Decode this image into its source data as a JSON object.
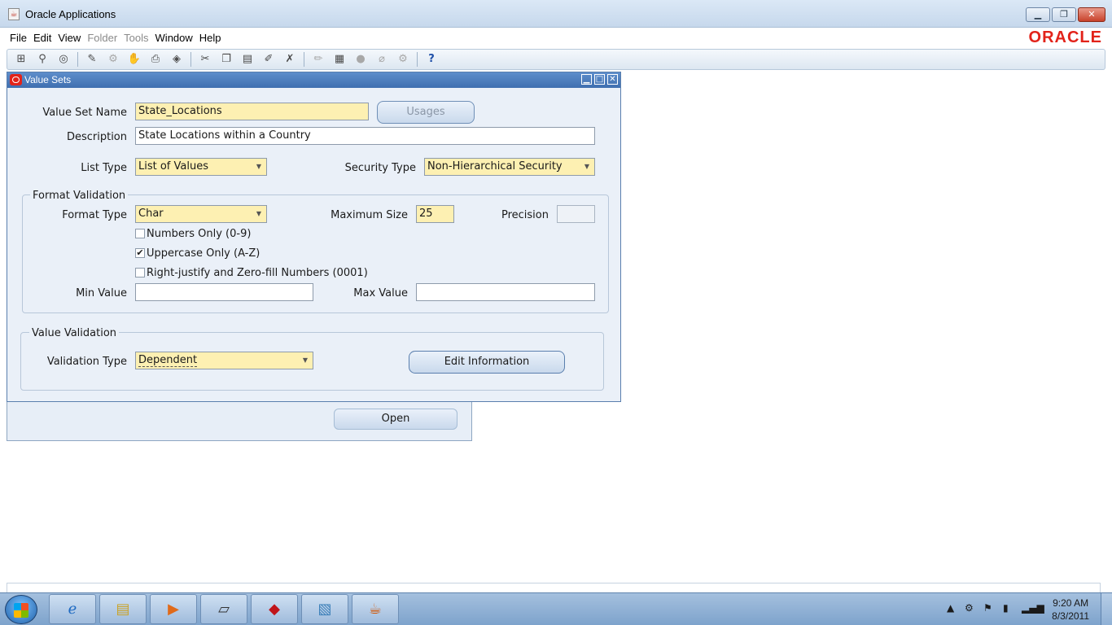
{
  "window": {
    "title": "Oracle Applications"
  },
  "menu": {
    "items": [
      {
        "label": "File",
        "enabled": true
      },
      {
        "label": "Edit",
        "enabled": true
      },
      {
        "label": "View",
        "enabled": true
      },
      {
        "label": "Folder",
        "enabled": false
      },
      {
        "label": "Tools",
        "enabled": false
      },
      {
        "label": "Window",
        "enabled": true
      },
      {
        "label": "Help",
        "enabled": true
      }
    ],
    "logo": "ORACLE"
  },
  "toolbar": {
    "help_glyph": "?"
  },
  "value_sets": {
    "title": "Value Sets",
    "value_set_name_label": "Value Set Name",
    "value_set_name": "State_Locations",
    "usages_button": "Usages",
    "description_label": "Description",
    "description": "State Locations within a Country",
    "list_type_label": "List Type",
    "list_type": "List of Values",
    "security_type_label": "Security Type",
    "security_type": "Non-Hierarchical Security",
    "format_validation": {
      "title": "Format Validation",
      "format_type_label": "Format Type",
      "format_type": "Char",
      "maximum_size_label": "Maximum Size",
      "maximum_size": "25",
      "precision_label": "Precision",
      "precision": "",
      "numbers_only_label": "Numbers Only (0-9)",
      "numbers_only": false,
      "uppercase_only_label": "Uppercase Only (A-Z)",
      "uppercase_only": true,
      "right_justify_label": "Right-justify and Zero-fill Numbers (0001)",
      "right_justify": false,
      "min_value_label": "Min Value",
      "min_value": "",
      "max_value_label": "Max Value",
      "max_value": ""
    },
    "value_validation": {
      "title": "Value Validation",
      "validation_type_label": "Validation Type",
      "validation_type": "Dependent",
      "edit_information_button": "Edit Information"
    }
  },
  "find_window": {
    "open_button": "Open"
  },
  "taskbar": {
    "clock_time": "9:20 AM",
    "clock_date": "8/3/2011"
  }
}
